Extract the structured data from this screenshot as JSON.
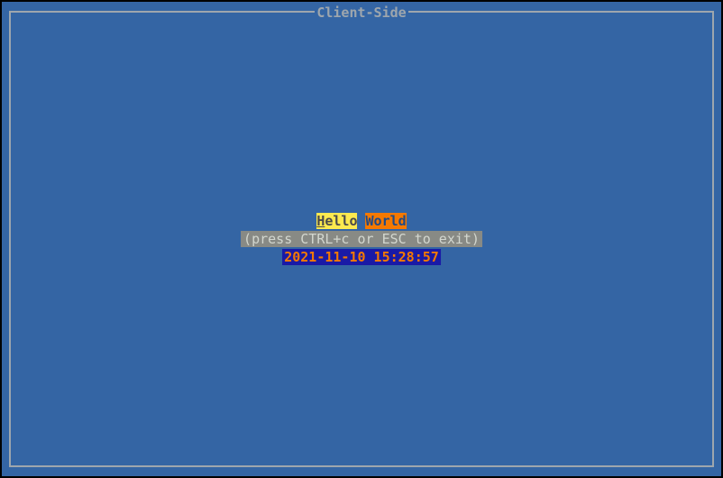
{
  "panel": {
    "title": "Client-Side"
  },
  "greeting": {
    "hello_first": "H",
    "hello_rest": "ello",
    "world": "World"
  },
  "hint": {
    "text": "(press CTRL+c or ESC to exit)"
  },
  "timestamp": {
    "value": "2021-11-10 15:28:57"
  }
}
